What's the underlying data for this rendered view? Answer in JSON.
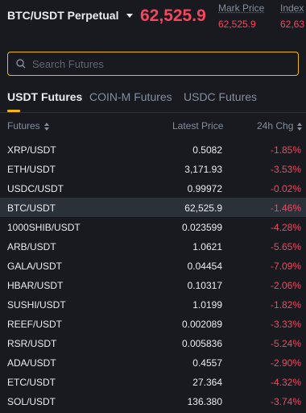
{
  "header": {
    "pair": "BTC/USDT Perpetual",
    "last_price": "62,525.9",
    "mark_label": "Mark Price",
    "mark_value": "62,525.9",
    "index_label": "Index",
    "index_value": "62,63"
  },
  "search": {
    "placeholder": "Search Futures",
    "icon": "search-icon"
  },
  "tabs": [
    "USDT Futures",
    "COIN-M Futures",
    "USDC Futures"
  ],
  "active_tab": "USDT Futures",
  "columns": {
    "symbol": "Futures",
    "price": "Latest Price",
    "change": "24h Chg"
  },
  "rows": [
    {
      "symbol": "XRP/USDT",
      "price": "0.5082",
      "change": "-1.85%"
    },
    {
      "symbol": "ETH/USDT",
      "price": "3,171.93",
      "change": "-3.53%"
    },
    {
      "symbol": "USDC/USDT",
      "price": "0.99972",
      "change": "-0.02%"
    },
    {
      "symbol": "BTC/USDT",
      "price": "62,525.9",
      "change": "-1.46%"
    },
    {
      "symbol": "1000SHIB/USDT",
      "price": "0.023599",
      "change": "-4.28%"
    },
    {
      "symbol": "ARB/USDT",
      "price": "1.0621",
      "change": "-5.65%"
    },
    {
      "symbol": "GALA/USDT",
      "price": "0.04454",
      "change": "-7.09%"
    },
    {
      "symbol": "HBAR/USDT",
      "price": "0.10317",
      "change": "-2.06%"
    },
    {
      "symbol": "SUSHI/USDT",
      "price": "1.0199",
      "change": "-1.82%"
    },
    {
      "symbol": "REEF/USDT",
      "price": "0.002089",
      "change": "-3.33%"
    },
    {
      "symbol": "RSR/USDT",
      "price": "0.005836",
      "change": "-5.24%"
    },
    {
      "symbol": "ADA/USDT",
      "price": "0.4557",
      "change": "-2.90%"
    },
    {
      "symbol": "ETC/USDT",
      "price": "27.364",
      "change": "-4.32%"
    },
    {
      "symbol": "SOL/USDT",
      "price": "136.380",
      "change": "-3.74%"
    }
  ],
  "highlighted_row": "BTC/USDT",
  "colors": {
    "background": "#181a20",
    "accent": "#f0b90b",
    "negative": "#f6465d",
    "text": "#eaecef",
    "muted": "#848e9c"
  }
}
